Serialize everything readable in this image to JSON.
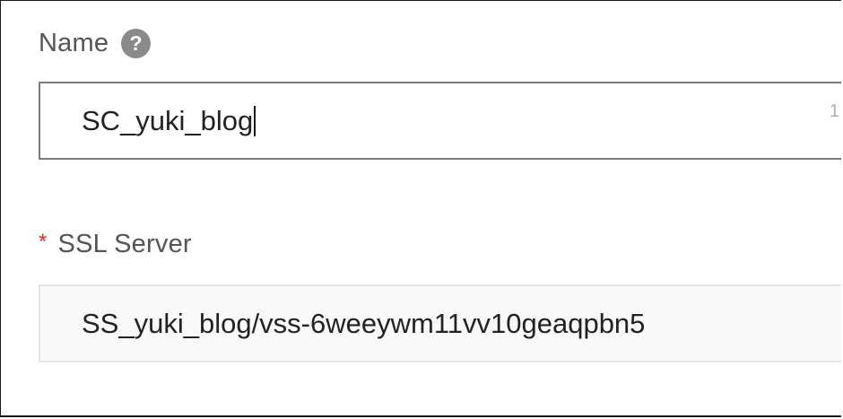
{
  "name_field": {
    "label": "Name",
    "help_icon": "question-circle-icon",
    "value": "SC_yuki_blog",
    "counter_hint": "1"
  },
  "ssl_field": {
    "required_mark": "*",
    "label": "SSL Server",
    "value": "SS_yuki_blog/vss-6weeywm11vv10geaqpbn5"
  },
  "colors": {
    "required": "#d93026",
    "help_icon_bg": "#8a8a8a",
    "input_border": "#7a7a7a",
    "disabled_border": "#e4e4e4",
    "disabled_bg": "#f9f9f9"
  }
}
